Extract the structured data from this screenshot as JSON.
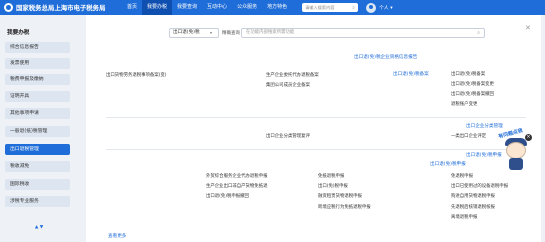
{
  "topbar": {
    "logo_text": "国家税务总局上海市电子税务局",
    "nav": [
      "首页",
      "我要办税",
      "我要查询",
      "互动中心",
      "公众服务",
      "地方特色"
    ],
    "nav_active_index": 1,
    "search_placeholder": "请输入搜索内容",
    "user_label": "个人 ▾"
  },
  "sidebar": {
    "title": "我要办税",
    "items": [
      {
        "label": "综合信息报告"
      },
      {
        "label": "发票使用"
      },
      {
        "label": "税费申报及缴纳"
      },
      {
        "label": "证明开具"
      },
      {
        "label": "其他事项申请"
      },
      {
        "label": "一般退(抵)税管理"
      },
      {
        "label": "出口退税管理",
        "active": true
      },
      {
        "label": "税收减免"
      },
      {
        "label": "国际税收"
      },
      {
        "label": "涉税专业服务"
      }
    ],
    "scroll_arrows": "▲ ▼"
  },
  "panel": {
    "dropdown_value": "出口退(免)税",
    "dropdown_caret": "▾",
    "search_button": "精确查询",
    "search_placeholder": "在功能内部搜索所需功能",
    "section_1": "出口退(免)税企业资格信息报告",
    "sub_1a": "出口退(免)税备案",
    "items_1a": [
      "出口退(免)税备案",
      "生产企业委托代办退税备案",
      "出口货物劳务退税事项备案(变)",
      "出口退(免)税备案变更",
      "集团公司成员企业备案",
      "出口退(免)税备案撤回",
      "退税账户变更"
    ],
    "section_2": "出口企业分类管理",
    "items_2": [
      "一类出口企业评定",
      "出口企业分类管理复评"
    ],
    "section_3": "出口退(免)税申报",
    "sub_3": "出口退(免)税申报",
    "items_3": [
      "免退税申报",
      "免抵退税申报",
      "外贸综合服务企业代办退税申报",
      "出口已使用过的设备退税申报",
      "出口(免)税申报",
      "生产企业出口非自产货物免抵退",
      "购进自用货物退税申报",
      "融资租赁货物退税申报",
      "出口退(免)税申报撤回",
      "先退税后核销退税核报",
      "跨境应税行为免抵退税申报",
      "离境退税申报"
    ],
    "more": "查看更多",
    "close": "✕"
  },
  "mascot": {
    "bubble": "有问题点我",
    "close": "×"
  }
}
